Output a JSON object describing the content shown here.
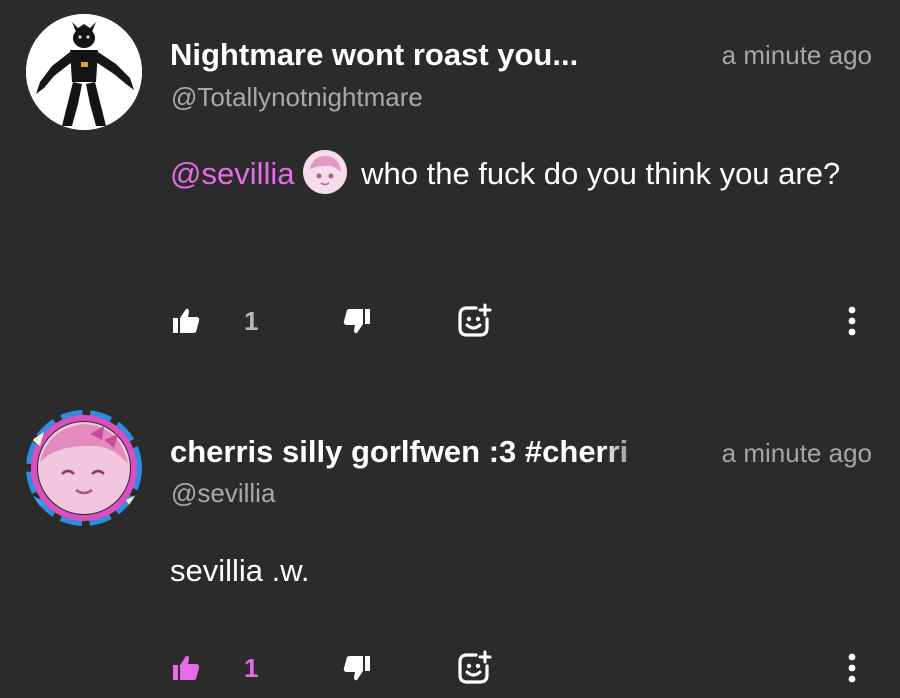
{
  "comments": [
    {
      "author": "Nightmare wont roast you...",
      "handle": "@Totallynotnightmare",
      "time": "a minute ago",
      "mention": "@sevillia",
      "text": "who the fuck do you think you are?",
      "likes": "1",
      "liked": false
    },
    {
      "author": "cherris silly gorlfwen :3 #cherri",
      "handle": "@sevillia",
      "time": "a minute ago",
      "text": "sevillia .w.",
      "likes": "1",
      "liked": true
    }
  ],
  "colors": {
    "background": "#2b2b2b",
    "mention": "#e66be6",
    "liked": "#e66be6",
    "muted": "#a6a6a6"
  },
  "icons": [
    "thumbs-up-icon",
    "thumbs-down-icon",
    "add-reaction-icon",
    "more-vertical-icon"
  ]
}
